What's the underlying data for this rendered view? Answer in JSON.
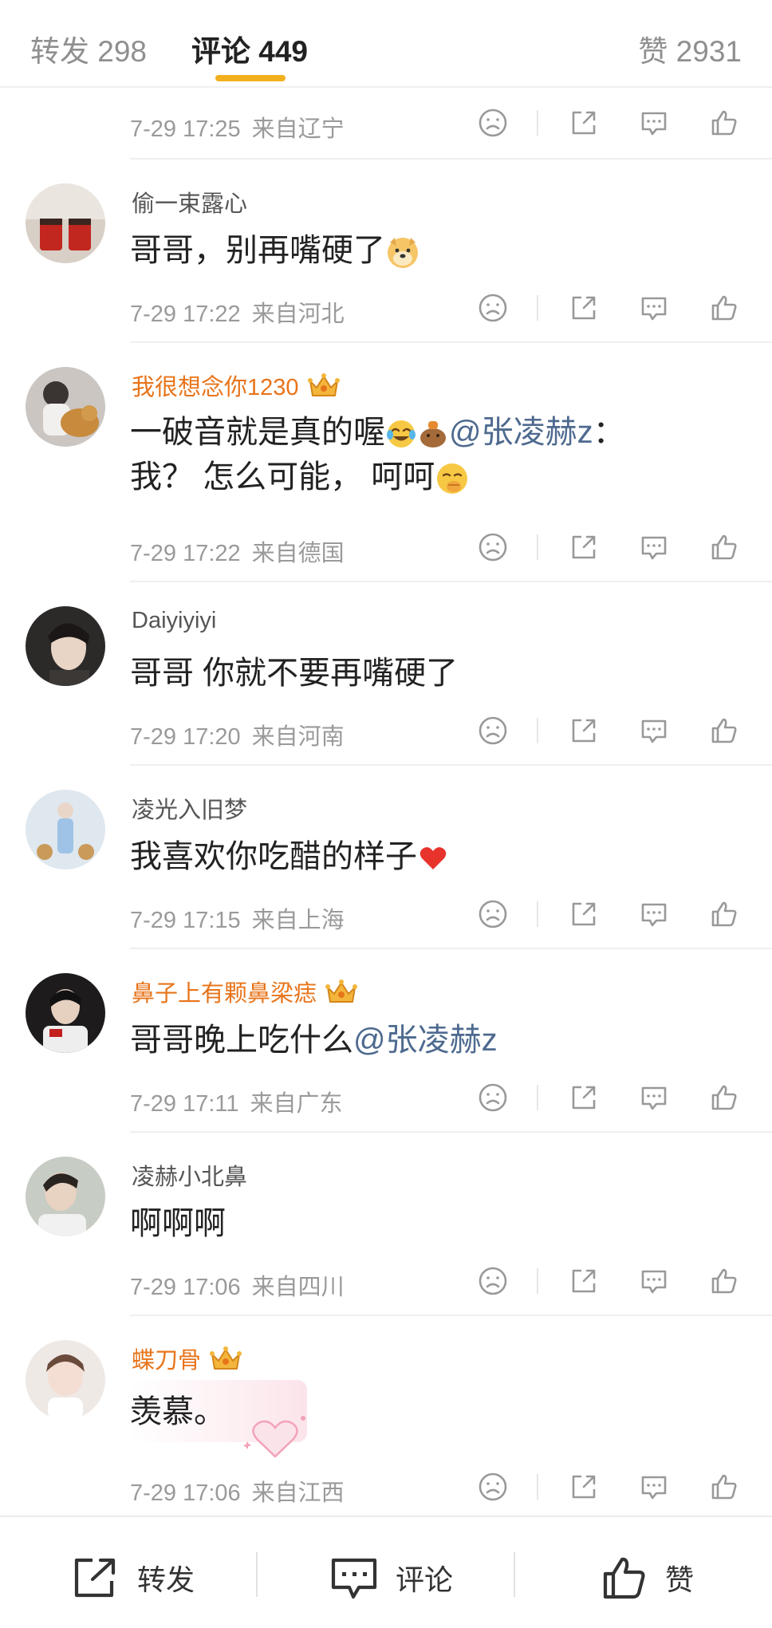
{
  "tabs": {
    "repost": "转发 298",
    "comment": "评论 449",
    "like": "赞 2931"
  },
  "comments": [
    {
      "meta_time": "7-29 17:25",
      "meta_loc": "来自辽宁"
    },
    {
      "username": "偷一束露心",
      "text": "哥哥，别再嘴硬了",
      "meta_time": "7-29 17:22",
      "meta_loc": "来自河北"
    },
    {
      "username": "我很想念你1230",
      "line1": "一破音就是真的喔",
      "mention": "@张凌赫z",
      "line1_end": "：",
      "line2": "我？ 怎么可能， 呵呵",
      "meta_time": "7-29 17:22",
      "meta_loc": "来自德国"
    },
    {
      "username": "Daiyiyiyi",
      "text": "哥哥 你就不要再嘴硬了",
      "meta_time": "7-29 17:20",
      "meta_loc": "来自河南"
    },
    {
      "username": "凌光入旧梦",
      "text": "我喜欢你吃醋的样子",
      "meta_time": "7-29 17:15",
      "meta_loc": "来自上海"
    },
    {
      "username": "鼻子上有颗鼻梁痣",
      "text": "哥哥晚上吃什么",
      "mention": "@张凌赫z",
      "meta_time": "7-29 17:11",
      "meta_loc": "来自广东"
    },
    {
      "username": "凌赫小北鼻",
      "text": "啊啊啊",
      "meta_time": "7-29 17:06",
      "meta_loc": "来自四川"
    },
    {
      "username": "蝶刀骨",
      "text": "羡慕。",
      "meta_time": "7-29 17:06",
      "meta_loc": "来自江西"
    }
  ],
  "bottom": {
    "repost": "转发",
    "comment": "评论",
    "like": "赞"
  },
  "colors": {
    "accent": "#f2b01e",
    "vip_name": "#e8741a",
    "mention": "#4e6a8f",
    "meta": "#9a9a9a"
  },
  "icons": [
    "dislike-icon",
    "share-icon",
    "comment-icon",
    "like-icon",
    "crown-icon"
  ]
}
